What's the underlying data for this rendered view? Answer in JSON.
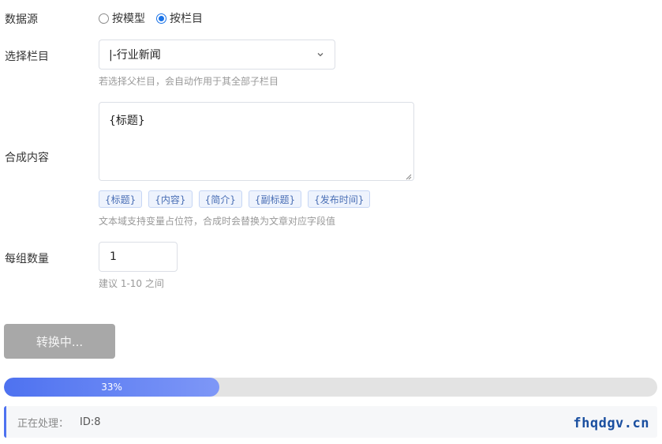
{
  "form": {
    "source": {
      "label": "数据源",
      "options": [
        {
          "label": "按模型",
          "checked": false
        },
        {
          "label": "按栏目",
          "checked": true
        }
      ]
    },
    "column": {
      "label": "选择栏目",
      "value": "|-行业新闻",
      "hint": "若选择父栏目，会自动作用于其全部子栏目"
    },
    "content": {
      "label": "合成内容",
      "value": "{标题}",
      "tags": [
        "{标题}",
        "{内容}",
        "{简介}",
        "{副标题}",
        "{发布时间}"
      ],
      "hint": "文本域支持变量占位符，合成时会替换为文章对应字段值"
    },
    "count": {
      "label": "每组数量",
      "value": "1",
      "hint": "建议 1-10 之间"
    }
  },
  "convert_button": {
    "label": "转换中..."
  },
  "progress": {
    "percent": 33,
    "label": "33%"
  },
  "status": {
    "label": "正在处理：",
    "value": "ID:8"
  },
  "watermark": "fhqdgv.cn",
  "colors": {
    "accent": "#4e72f0",
    "button_disabled": "#a8a8a8"
  }
}
